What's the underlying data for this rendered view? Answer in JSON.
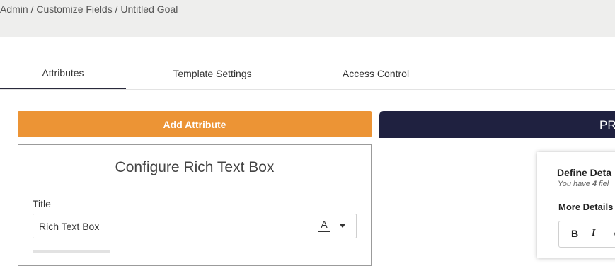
{
  "breadcrumb": "Admin / Customize Fields / Untitled Goal",
  "tabs": [
    {
      "label": "Attributes",
      "active": true
    },
    {
      "label": "Template Settings",
      "active": false
    },
    {
      "label": "Access Control",
      "active": false
    }
  ],
  "add_attribute_label": "Add Attribute",
  "preview": {
    "header_label": "PR"
  },
  "config": {
    "title": "Configure Rich Text Box",
    "field_label": "Title",
    "field_value": "Rich Text Box",
    "text_color_glyph": "A"
  },
  "preview_card": {
    "title": "Define Deta",
    "subtitle_prefix": "You have ",
    "subtitle_count": "4",
    "subtitle_suffix": " fiel",
    "section_label": "More Details",
    "toolbar": {
      "bold": "B",
      "italic": "I",
      "link": "⊙"
    }
  },
  "colors": {
    "accent": "#ec9435",
    "preview_header": "#1f2140",
    "topbar": "#eeeeed"
  }
}
